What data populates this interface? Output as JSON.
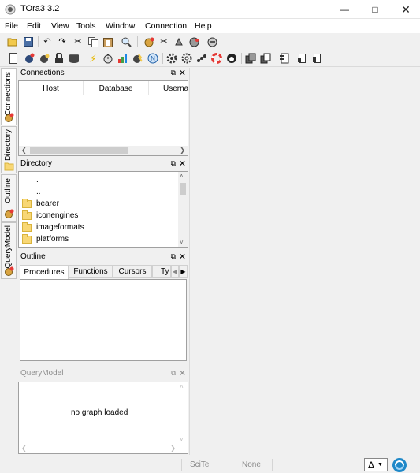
{
  "window": {
    "title": "TOra3 3.2"
  },
  "menu": [
    "File",
    "Edit",
    "View",
    "Tools",
    "Window",
    "Connection",
    "Help"
  ],
  "toolbar": {
    "connection_combo_value": ""
  },
  "side_tabs": [
    "Connections",
    "Directory",
    "Outline",
    "QueryModel"
  ],
  "connections": {
    "title": "Connections",
    "columns": [
      "Host",
      "Database",
      "Userna"
    ]
  },
  "directory": {
    "title": "Directory",
    "items": [
      ".",
      "..",
      "bearer",
      "iconengines",
      "imageformats",
      "platforms"
    ]
  },
  "outline": {
    "title": "Outline",
    "tabs": [
      "Procedures",
      "Functions",
      "Cursors",
      "Ty"
    ]
  },
  "querymodel": {
    "title": "QueryModel",
    "empty_text": "no graph loaded"
  },
  "status": {
    "editor": "SciTe",
    "mode": "None",
    "delta": "Δ"
  }
}
